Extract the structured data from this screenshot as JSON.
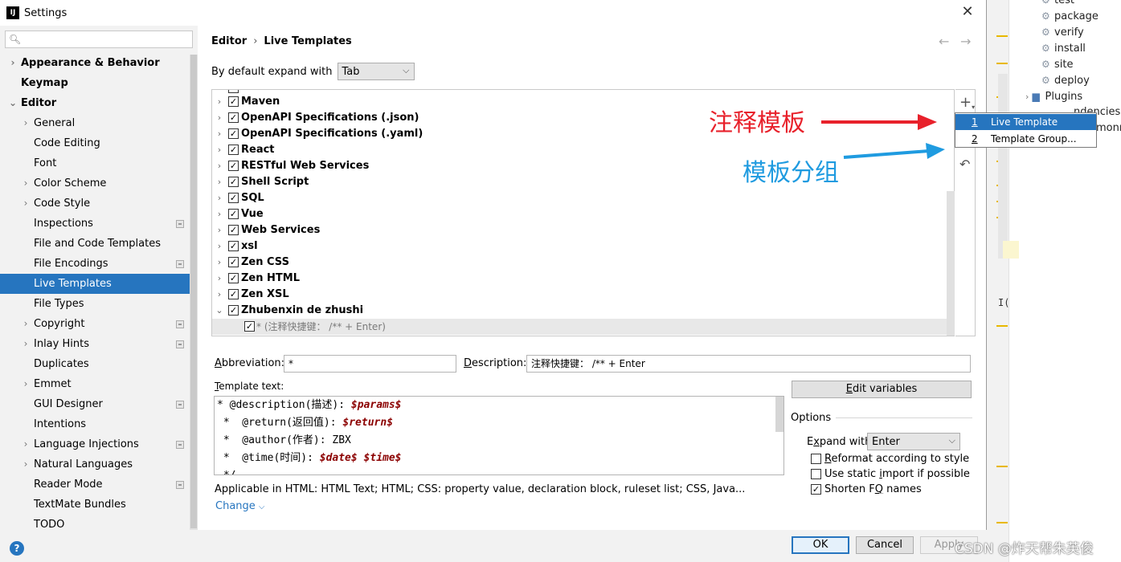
{
  "window": {
    "title": "Settings",
    "app_icon": "IJ"
  },
  "search": {
    "placeholder": ""
  },
  "sidebar": {
    "items": [
      {
        "label": "Appearance & Behavior",
        "level": 0,
        "arrow": "right",
        "bold": true
      },
      {
        "label": "Keymap",
        "level": 0,
        "arrow": "",
        "bold": true
      },
      {
        "label": "Editor",
        "level": 0,
        "arrow": "down",
        "bold": true
      },
      {
        "label": "General",
        "level": 1,
        "arrow": "right"
      },
      {
        "label": "Code Editing",
        "level": 1,
        "arrow": ""
      },
      {
        "label": "Font",
        "level": 1,
        "arrow": ""
      },
      {
        "label": "Color Scheme",
        "level": 1,
        "arrow": "right"
      },
      {
        "label": "Code Style",
        "level": 1,
        "arrow": "right"
      },
      {
        "label": "Inspections",
        "level": 1,
        "arrow": "",
        "badge": true
      },
      {
        "label": "File and Code Templates",
        "level": 1,
        "arrow": ""
      },
      {
        "label": "File Encodings",
        "level": 1,
        "arrow": "",
        "badge": true
      },
      {
        "label": "Live Templates",
        "level": 1,
        "arrow": "",
        "selected": true
      },
      {
        "label": "File Types",
        "level": 1,
        "arrow": ""
      },
      {
        "label": "Copyright",
        "level": 1,
        "arrow": "right",
        "badge": true
      },
      {
        "label": "Inlay Hints",
        "level": 1,
        "arrow": "right",
        "badge": true
      },
      {
        "label": "Duplicates",
        "level": 1,
        "arrow": ""
      },
      {
        "label": "Emmet",
        "level": 1,
        "arrow": "right"
      },
      {
        "label": "GUI Designer",
        "level": 1,
        "arrow": "",
        "badge": true
      },
      {
        "label": "Intentions",
        "level": 1,
        "arrow": ""
      },
      {
        "label": "Language Injections",
        "level": 1,
        "arrow": "right",
        "badge": true
      },
      {
        "label": "Natural Languages",
        "level": 1,
        "arrow": "right"
      },
      {
        "label": "Reader Mode",
        "level": 1,
        "arrow": "",
        "badge": true
      },
      {
        "label": "TextMate Bundles",
        "level": 1,
        "arrow": ""
      },
      {
        "label": "TODO",
        "level": 1,
        "arrow": ""
      }
    ]
  },
  "breadcrumb": {
    "parent": "Editor",
    "separator": "›",
    "current": "Live Templates"
  },
  "expand": {
    "label": "By default expand with",
    "value": "Tab"
  },
  "template_groups": [
    {
      "name": "Maven",
      "checked": true
    },
    {
      "name": "OpenAPI Specifications (.json)",
      "checked": true
    },
    {
      "name": "OpenAPI Specifications (.yaml)",
      "checked": true
    },
    {
      "name": "React",
      "checked": true
    },
    {
      "name": "RESTful Web Services",
      "checked": true
    },
    {
      "name": "Shell Script",
      "checked": true
    },
    {
      "name": "SQL",
      "checked": true
    },
    {
      "name": "Vue",
      "checked": true
    },
    {
      "name": "Web Services",
      "checked": true
    },
    {
      "name": "xsl",
      "checked": true
    },
    {
      "name": "Zen CSS",
      "checked": true
    },
    {
      "name": "Zen HTML",
      "checked": true
    },
    {
      "name": "Zen XSL",
      "checked": true
    },
    {
      "name": "Zhubenxin de zhushi",
      "checked": true,
      "expanded": true
    }
  ],
  "template_child": {
    "text": "* (注释快捷键： /** + Enter)",
    "checked": true
  },
  "popup": {
    "items": [
      {
        "num": "1",
        "label": "Live Template",
        "selected": true
      },
      {
        "num": "2",
        "label": "Template Group...",
        "selected": false
      }
    ]
  },
  "annotations": {
    "red": "注释模板",
    "blue": "模板分组",
    "red_color": "#e8212b",
    "blue_color": "#1f9be0"
  },
  "form": {
    "abbreviation_label": "Abbreviation:",
    "abbreviation_value": "*",
    "description_label": "Description:",
    "description_value": "注释快捷键： /** + Enter",
    "template_text_label": "Template text:",
    "template_lines": [
      {
        "pre": "* @description(描述): ",
        "var": "$params$"
      },
      {
        "pre": " *  @return(返回值): ",
        "var": "$return$"
      },
      {
        "pre": " *  @author(作者): ZBX",
        "var": ""
      },
      {
        "pre": " *  @time(时间): ",
        "var": "$date$ $time$"
      },
      {
        "pre": " */",
        "var": ""
      }
    ],
    "applicable": "Applicable in HTML: HTML Text; HTML; CSS: property value, declaration block, ruleset list; CSS, Java...",
    "change_link": "Change"
  },
  "options": {
    "edit_variables": "Edit variables",
    "title": "Options",
    "expand_label": "Expand with",
    "expand_value": "Enter",
    "reformat": {
      "label": "Reformat according to style",
      "checked": false
    },
    "static_import": {
      "label": "Use static import if possible",
      "checked": false
    },
    "shorten": {
      "label": "Shorten FQ names",
      "checked": true
    }
  },
  "buttons": {
    "ok": "OK",
    "cancel": "Cancel",
    "apply": "Apply"
  },
  "background_ide": {
    "maven_items": [
      "test",
      "package",
      "verify",
      "install",
      "site",
      "deploy"
    ],
    "plugins": "Plugins",
    "partial1": "ndencies",
    "partial2": "monm"
  },
  "watermark": "CSDN @炸天帮朱英俊",
  "accent": "#2675bf"
}
